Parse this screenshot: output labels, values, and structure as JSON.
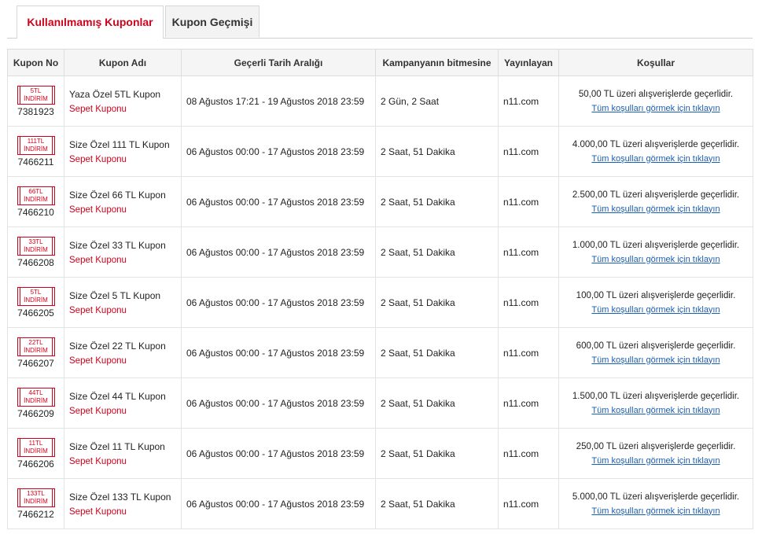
{
  "tabs": [
    {
      "label": "Kullanılmamış Kuponlar"
    },
    {
      "label": "Kupon Geçmişi"
    }
  ],
  "table": {
    "headers": [
      "Kupon No",
      "Kupon Adı",
      "Geçerli Tarih Aralığı",
      "Kampanyanın bitmesine",
      "Yayınlayan",
      "Koşullar"
    ],
    "rows": [
      {
        "badge_amount": "5TL",
        "badge_text": "İNDİRİM",
        "id": "7381923",
        "name": "Yaza Özel 5TL Kupon",
        "type": "Sepet Kuponu",
        "dates": "08 Ağustos 17:21 - 19 Ağustos 2018 23:59",
        "remaining": "2 Gün, 2 Saat",
        "publisher": "n11.com",
        "condition": "50,00 TL üzeri alışverişlerde geçerlidir.",
        "link": "Tüm koşulları görmek için tıklayın"
      },
      {
        "badge_amount": "111TL",
        "badge_text": "İNDİRİM",
        "id": "7466211",
        "name": "Size Özel 111 TL Kupon",
        "type": "Sepet Kuponu",
        "dates": "06 Ağustos 00:00 - 17 Ağustos 2018 23:59",
        "remaining": "2 Saat, 51 Dakika",
        "publisher": "n11.com",
        "condition": "4.000,00 TL üzeri alışverişlerde geçerlidir.",
        "link": "Tüm koşulları görmek için tıklayın"
      },
      {
        "badge_amount": "66TL",
        "badge_text": "İNDİRİM",
        "id": "7466210",
        "name": "Size Özel 66 TL Kupon",
        "type": "Sepet Kuponu",
        "dates": "06 Ağustos 00:00 - 17 Ağustos 2018 23:59",
        "remaining": "2 Saat, 51 Dakika",
        "publisher": "n11.com",
        "condition": "2.500,00 TL üzeri alışverişlerde geçerlidir.",
        "link": "Tüm koşulları görmek için tıklayın"
      },
      {
        "badge_amount": "33TL",
        "badge_text": "İNDİRİM",
        "id": "7466208",
        "name": "Size Özel 33 TL Kupon",
        "type": "Sepet Kuponu",
        "dates": "06 Ağustos 00:00 - 17 Ağustos 2018 23:59",
        "remaining": "2 Saat, 51 Dakika",
        "publisher": "n11.com",
        "condition": "1.000,00 TL üzeri alışverişlerde geçerlidir.",
        "link": "Tüm koşulları görmek için tıklayın"
      },
      {
        "badge_amount": "5TL",
        "badge_text": "İNDİRİM",
        "id": "7466205",
        "name": "Size Özel 5 TL Kupon",
        "type": "Sepet Kuponu",
        "dates": "06 Ağustos 00:00 - 17 Ağustos 2018 23:59",
        "remaining": "2 Saat, 51 Dakika",
        "publisher": "n11.com",
        "condition": "100,00 TL üzeri alışverişlerde geçerlidir.",
        "link": "Tüm koşulları görmek için tıklayın"
      },
      {
        "badge_amount": "22TL",
        "badge_text": "İNDİRİM",
        "id": "7466207",
        "name": "Size Özel 22 TL Kupon",
        "type": "Sepet Kuponu",
        "dates": "06 Ağustos 00:00 - 17 Ağustos 2018 23:59",
        "remaining": "2 Saat, 51 Dakika",
        "publisher": "n11.com",
        "condition": "600,00 TL üzeri alışverişlerde geçerlidir.",
        "link": "Tüm koşulları görmek için tıklayın"
      },
      {
        "badge_amount": "44TL",
        "badge_text": "İNDİRİM",
        "id": "7466209",
        "name": "Size Özel 44 TL Kupon",
        "type": "Sepet Kuponu",
        "dates": "06 Ağustos 00:00 - 17 Ağustos 2018 23:59",
        "remaining": "2 Saat, 51 Dakika",
        "publisher": "n11.com",
        "condition": "1.500,00 TL üzeri alışverişlerde geçerlidir.",
        "link": "Tüm koşulları görmek için tıklayın"
      },
      {
        "badge_amount": "11TL",
        "badge_text": "İNDİRİM",
        "id": "7466206",
        "name": "Size Özel 11 TL Kupon",
        "type": "Sepet Kuponu",
        "dates": "06 Ağustos 00:00 - 17 Ağustos 2018 23:59",
        "remaining": "2 Saat, 51 Dakika",
        "publisher": "n11.com",
        "condition": "250,00 TL üzeri alışverişlerde geçerlidir.",
        "link": "Tüm koşulları görmek için tıklayın"
      },
      {
        "badge_amount": "133TL",
        "badge_text": "İNDİRİM",
        "id": "7466212",
        "name": "Size Özel 133 TL Kupon",
        "type": "Sepet Kuponu",
        "dates": "06 Ağustos 00:00 - 17 Ağustos 2018 23:59",
        "remaining": "2 Saat, 51 Dakika",
        "publisher": "n11.com",
        "condition": "5.000,00 TL üzeri alışverişlerde geçerlidir.",
        "link": "Tüm koşulları görmek için tıklayın"
      }
    ]
  },
  "colors": {
    "accent": "#d0021b",
    "link": "#1a5fb4",
    "header_bg": "#f5f5f5"
  }
}
